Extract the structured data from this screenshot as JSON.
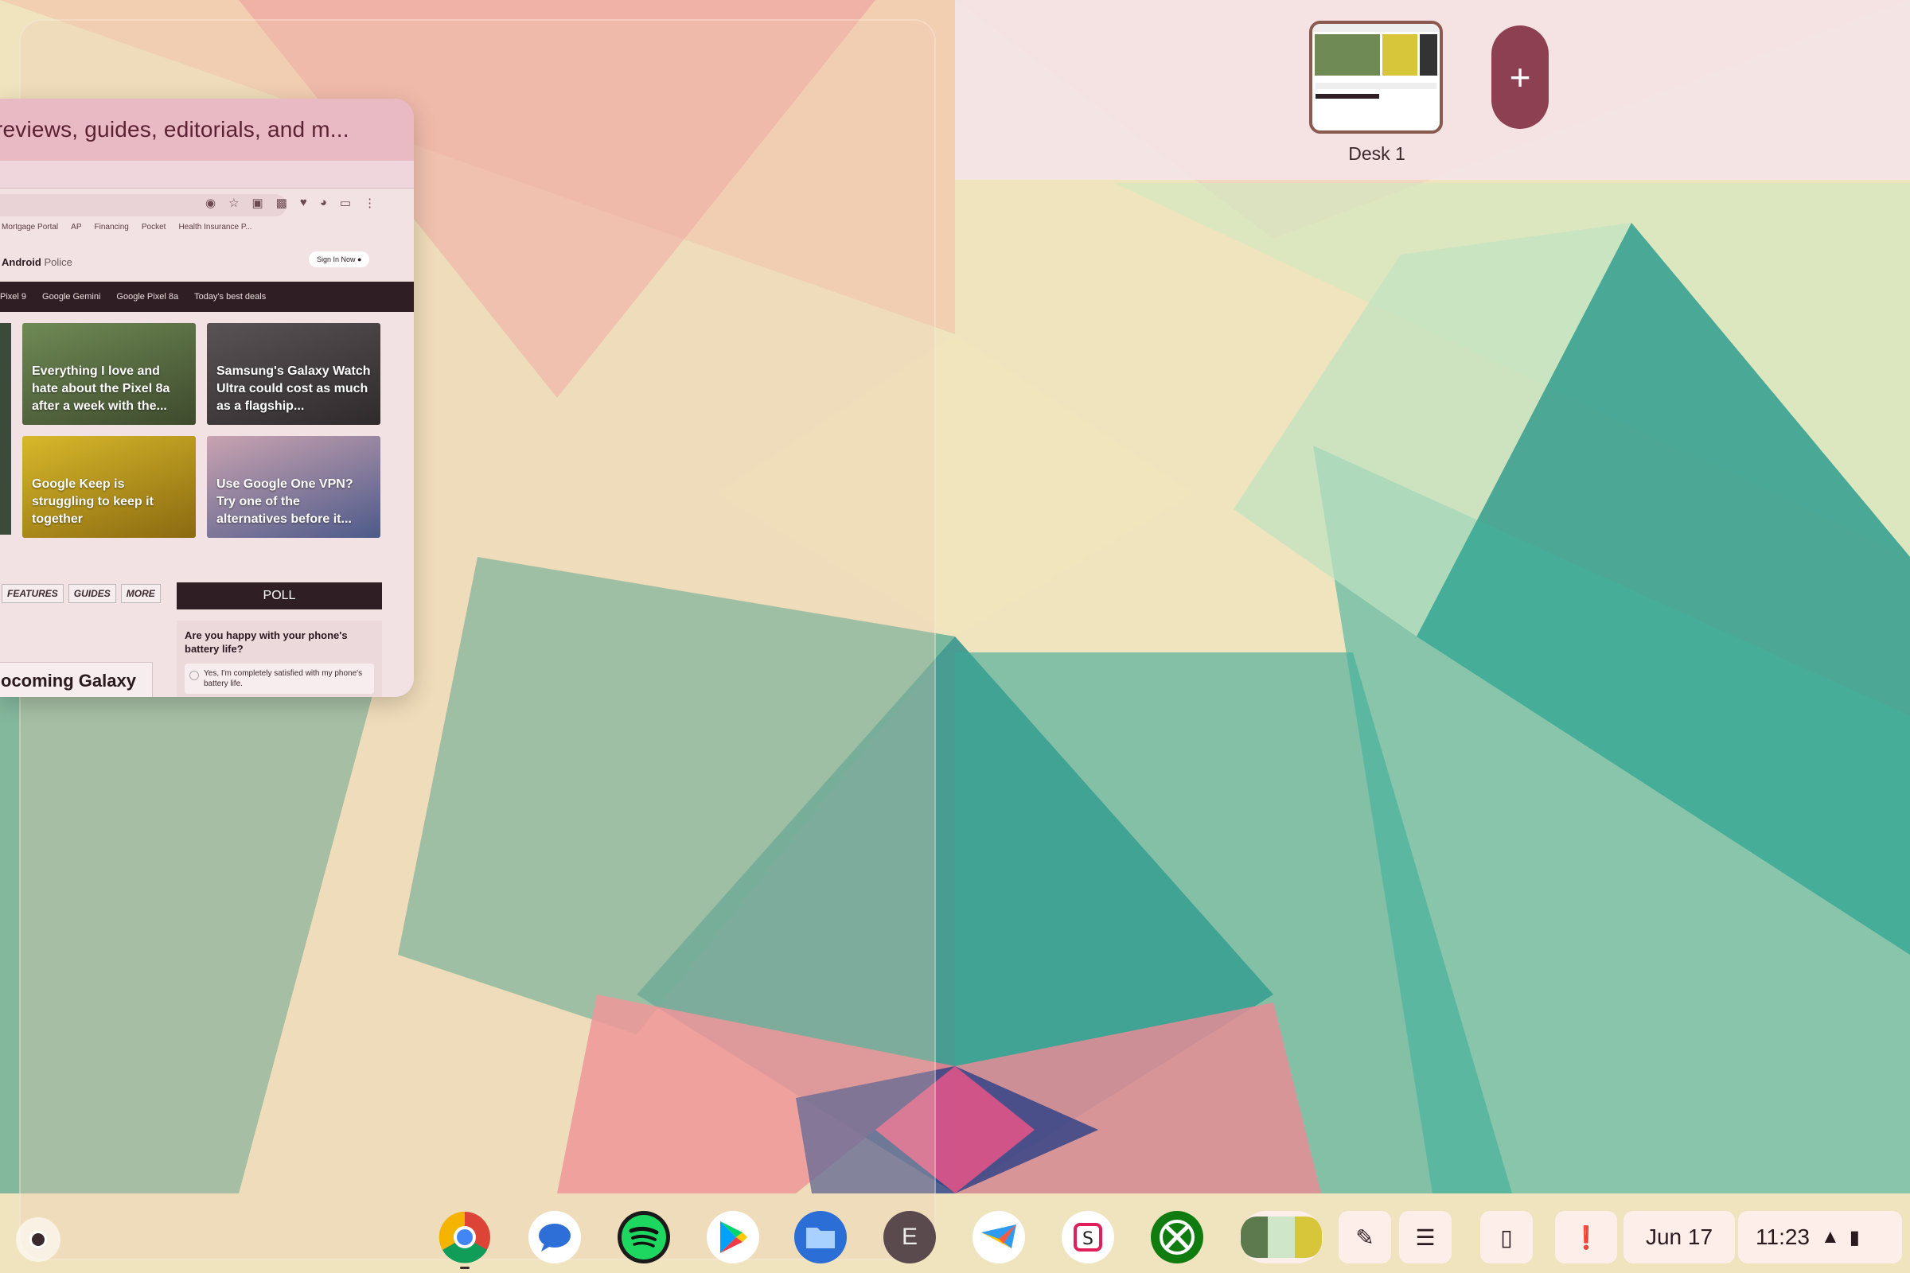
{
  "window": {
    "title": "reviews, guides, editorials, and m...",
    "bookmarks": [
      "Mortgage Portal",
      "AP",
      "Financing",
      "Pocket",
      "Health Insurance P..."
    ],
    "site_name_bold": "Android",
    "site_name_rest": "Police",
    "sign_in": "Sign In Now",
    "nav": [
      "Pixel 9",
      "Google Gemini",
      "Google Pixel 8a",
      "Today's best deals"
    ],
    "cards": [
      "Everything I love and hate about the Pixel 8a after a week with the...",
      "Samsung's Galaxy Watch Ultra could cost as much as a flagship...",
      "Google Keep is struggling to keep it together",
      "Use Google One VPN? Try one of the alternatives before it..."
    ],
    "tabs": [
      "FEATURES",
      "GUIDES",
      "MORE"
    ],
    "poll_header": "POLL",
    "poll_question": "Are you happy with your phone's battery life?",
    "poll_option": "Yes, I'm completely satisfied with my phone's battery life.",
    "story_title": "ocoming Galaxy"
  },
  "desks": {
    "desk_label": "Desk 1",
    "new_desk_symbol": "+"
  },
  "shelf": {
    "apps": [
      "chrome-icon",
      "messages-icon",
      "spotify-icon",
      "play-store-icon",
      "files-icon",
      "e-app-icon",
      "airmail-icon",
      "slack-icon",
      "xbox-icon"
    ],
    "e_app_letter": "E",
    "date": "Jun 17",
    "time": "11:23"
  }
}
